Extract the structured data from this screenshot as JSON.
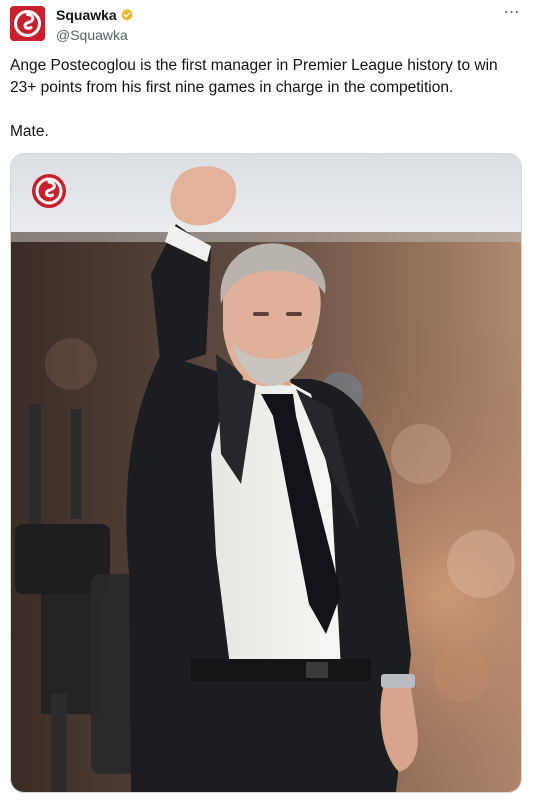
{
  "tweet": {
    "author": {
      "display_name": "Squawka",
      "handle": "@Squawka",
      "verified": true,
      "verified_color": "#e8b829",
      "brand_color": "#c8202e"
    },
    "more_icon": "⋯",
    "text_lines": [
      "Ange Postecoglou is the first manager in Premier League history to win 23+ points from his first nine games in charge in the competition.",
      "Mate."
    ],
    "media": {
      "icon": "photo",
      "watermark_icon": "squawka-logo-icon"
    }
  }
}
